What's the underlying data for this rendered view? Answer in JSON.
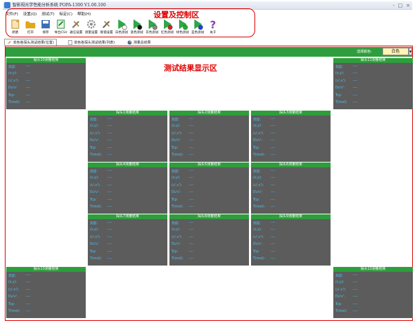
{
  "window": {
    "title": "智影视光学性能分析系统 POPA-1300 V1.00.100",
    "controls": [
      "-",
      "□",
      "×"
    ]
  },
  "menu": [
    "文件(F)",
    "设置(Q)",
    "测试(T)",
    "标定(C)",
    "帮助(H)"
  ],
  "toolbar": [
    {
      "label": "新建",
      "icon": "new-file-icon",
      "color": "#c98b1b"
    },
    {
      "label": "打开",
      "icon": "open-folder-icon",
      "color": "#e0a81c"
    },
    {
      "label": "保存",
      "icon": "save-disk-icon",
      "color": "#3b6fb5"
    },
    {
      "label": "导出CSV",
      "icon": "export-csv-icon",
      "color": "#2d8f3b"
    },
    {
      "label": "通信设置",
      "icon": "wrench-tools-icon",
      "color": "#7a7a7a"
    },
    {
      "label": "测量设置",
      "icon": "gear-settings-icon",
      "color": "#8a8a8a"
    },
    {
      "label": "限值设置",
      "icon": "ruler-tools-icon",
      "color": "#6b6b6b"
    },
    {
      "label": "白色测试",
      "icon": "play-white-icon",
      "color": "#ffffff"
    },
    {
      "label": "黑色测试",
      "icon": "play-black-icon",
      "color": "#111111"
    },
    {
      "label": "灰色测试",
      "icon": "play-gray-icon",
      "color": "#8a8a8a"
    },
    {
      "label": "红色测试",
      "icon": "play-red-icon",
      "color": "#e02020"
    },
    {
      "label": "绿色测试",
      "icon": "play-green-icon",
      "color": "#20b030"
    },
    {
      "label": "蓝色测试",
      "icon": "play-blue-icon",
      "color": "#2040e0"
    },
    {
      "label": "关于",
      "icon": "help-question-icon",
      "color": "#8a3fb0"
    }
  ],
  "zone_labels": {
    "controls": "设置及控制区",
    "results": "测试结果显示区"
  },
  "tabs": [
    {
      "label": "单色各探头测试结果(位置)",
      "active": true
    },
    {
      "label": "单色各探头测试结果(列表)",
      "active": false
    },
    {
      "label": "测量总结果",
      "active": false
    }
  ],
  "color_select": {
    "label": "选择颜色:",
    "value": "白色"
  },
  "panel_rows": [
    {
      "label": "亮度:",
      "value": "----"
    },
    {
      "label": "(x,y):",
      "value": "----"
    },
    {
      "label": "(u',v'):",
      "value": "----"
    },
    {
      "label": "Du'v':",
      "value": "----"
    },
    {
      "label": "Tcp:",
      "value": "----"
    },
    {
      "label": "T(mol):",
      "value": "----"
    }
  ],
  "panels": [
    {
      "title": "探头10测量结果"
    },
    {
      "title": "探头11测量结果"
    },
    {
      "title": "探头1测量结果"
    },
    {
      "title": "探头2测量结果"
    },
    {
      "title": "探头3测量结果"
    },
    {
      "title": "探头4测量结果"
    },
    {
      "title": "探头5测量结果"
    },
    {
      "title": "探头6测量结果"
    },
    {
      "title": "探头7测量结果"
    },
    {
      "title": "探头8测量结果"
    },
    {
      "title": "探头9测量结果"
    },
    {
      "title": "探头13测量结果"
    },
    {
      "title": "探头12测量结果"
    }
  ],
  "colors": {
    "panel_bg": "#5c5c5c",
    "panel_header": "#2e9e3c",
    "value_text": "#4fc3f7",
    "annotation": "#e00000"
  }
}
